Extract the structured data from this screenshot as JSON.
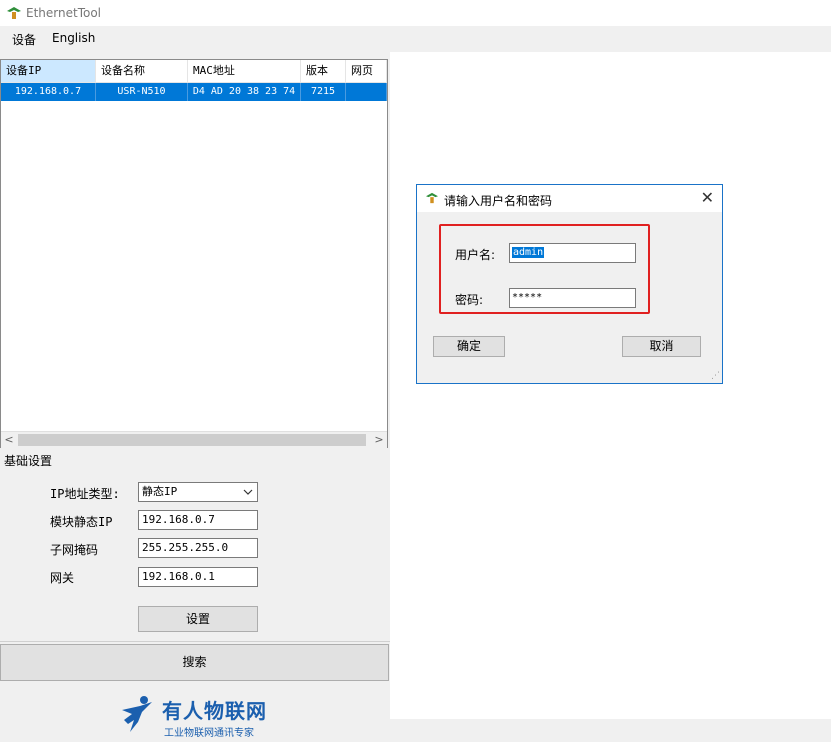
{
  "window": {
    "title": "EthernetTool"
  },
  "menu": {
    "items": [
      "设备",
      "English"
    ]
  },
  "device_list": {
    "columns": [
      "设备IP",
      "设备名称",
      "MAC地址",
      "版本",
      "网页"
    ],
    "rows": [
      {
        "ip": "192.168.0.7",
        "name": "USR-N510",
        "mac": "D4 AD 20 38 23 74",
        "version": "7215",
        "web": ""
      }
    ],
    "scroll_left": "<",
    "scroll_right": ">"
  },
  "basic_settings": {
    "legend": "基础设置",
    "ip_type_label": "IP地址类型:",
    "ip_type_value": "静态IP",
    "static_ip_label": "模块静态IP",
    "static_ip_value": "192.168.0.7",
    "subnet_label": "子网掩码",
    "subnet_value": "255.255.255.0",
    "gateway_label": "网关",
    "gateway_value": "192.168.0.1",
    "set_button": "设置"
  },
  "search_button": "搜索",
  "logo": {
    "main": "有人物联网",
    "sub": "工业物联网通讯专家"
  },
  "login_dialog": {
    "title": "请输入用户名和密码",
    "close": "✕",
    "username_label": "用户名:",
    "username_value": "admin",
    "password_label": "密码:",
    "password_value": "*****",
    "ok_button": "确定",
    "cancel_button": "取消"
  },
  "colors": {
    "selection": "#0078d7",
    "accent": "#1b5fae",
    "highlight_box": "#e02020"
  }
}
